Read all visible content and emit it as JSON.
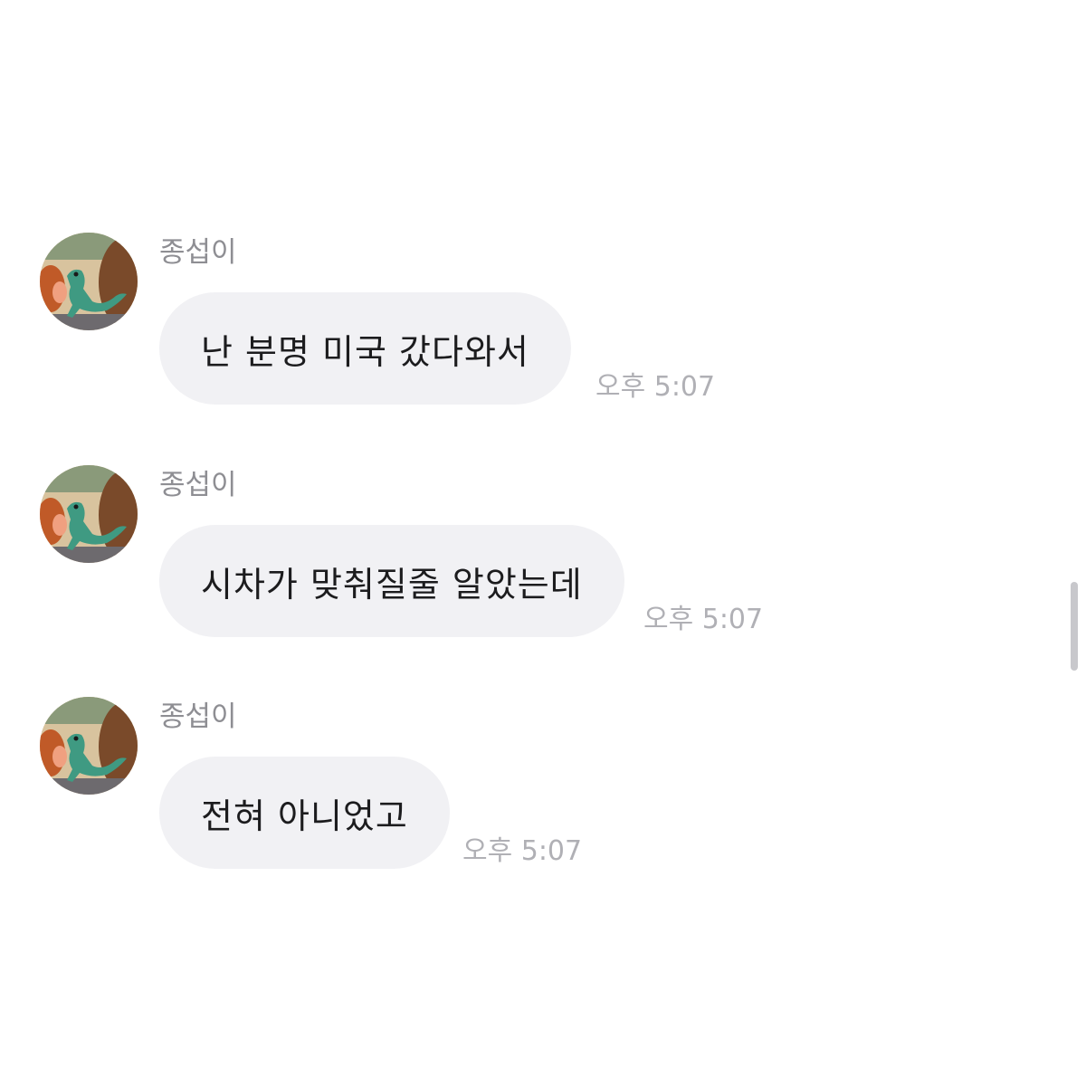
{
  "messages": [
    {
      "sender": "종섭이",
      "avatar_icon": "lizard-avatar-icon",
      "text": "난 분명 미국 갔다와서",
      "time": "오후 5:07"
    },
    {
      "sender": "종섭이",
      "avatar_icon": "lizard-avatar-icon",
      "text": "시차가 맞춰질줄 알았는데",
      "time": "오후 5:07"
    },
    {
      "sender": "종섭이",
      "avatar_icon": "lizard-avatar-icon",
      "text": "전혀 아니었고",
      "time": "오후 5:07"
    }
  ],
  "colors": {
    "bubble_bg": "#f1f1f4",
    "message_text": "#1c1c1e",
    "sender_text": "#8e8e93",
    "time_text": "#b0b0b5",
    "scrollbar": "#c8c8cc"
  }
}
